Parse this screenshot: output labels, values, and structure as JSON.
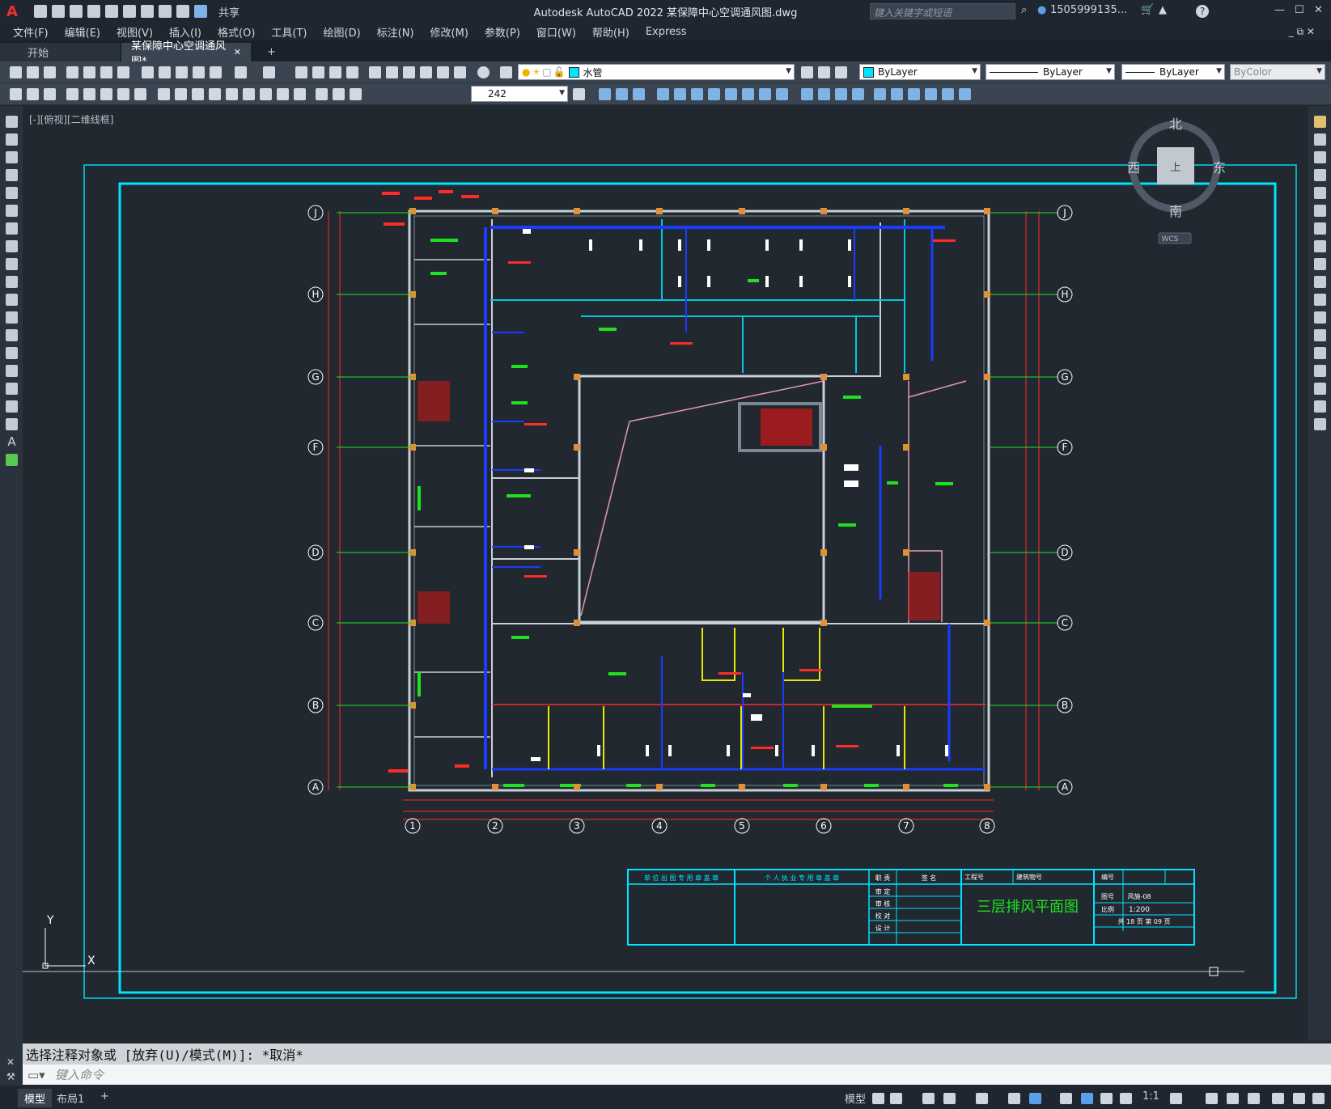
{
  "app": {
    "title": "Autodesk AutoCAD 2022    某保障中心空调通风图.dwg",
    "logo": "A",
    "share": "共享",
    "search_placeholder": "键入关键字或短语",
    "user": "1505999135...",
    "help": "?"
  },
  "menu": [
    "文件(F)",
    "编辑(E)",
    "视图(V)",
    "插入(I)",
    "格式(O)",
    "工具(T)",
    "绘图(D)",
    "标注(N)",
    "修改(M)",
    "参数(P)",
    "窗口(W)",
    "帮助(H)",
    "Express"
  ],
  "tabs": {
    "start": "开始",
    "doc": "某保障中心空调通风图*",
    "close": "✕",
    "add": "+"
  },
  "toolbar": {
    "layer": "水管",
    "color": "ByLayer",
    "linetype": "ByLayer",
    "lineweight": "ByLayer",
    "plotstyle": "ByColor",
    "dimscale": "242"
  },
  "viewport": {
    "label": "[-][俯视][二维线框]",
    "compass": {
      "north": "北",
      "south": "南",
      "east": "东",
      "west": "西",
      "center": "上",
      "wcs": "WCS"
    },
    "ucs": {
      "x": "X",
      "y": "Y"
    }
  },
  "drawing": {
    "grid_rows": [
      "J",
      "H",
      "G",
      "F",
      "D",
      "C",
      "B",
      "A"
    ],
    "grid_cols": [
      "1",
      "2",
      "3",
      "4",
      "5",
      "6",
      "7",
      "8"
    ],
    "title_block": {
      "unit_seal": "单 位 出 图 专 用 章 盖 章",
      "personal_seal": "个 人 执 业 专 用 章 盖 章",
      "role": "职 责",
      "sign": "签 名",
      "project_no": "工程号",
      "building_no": "建筑物号",
      "number": "编号",
      "drawing_title": "三层排风平面图",
      "drawing_no_label": "图号",
      "drawing_no": "风施-08",
      "scale_label": "比例",
      "scale": "1:200",
      "pages": "共   18   页  第   09   页",
      "roles": [
        "审 定",
        "审 核",
        "校 对",
        "设 计"
      ]
    }
  },
  "command": {
    "history": "选择注释对象或 [放弃(U)/模式(M)]: *取消*",
    "placeholder": "键入命令"
  },
  "status": {
    "tabs": [
      "模型",
      "布局1"
    ],
    "add": "+",
    "model_label": "模型",
    "scale": "1:1"
  },
  "colors": {
    "accent_red": "#e8322c",
    "cyan": "#00e5ff",
    "wall": "#c8cfd6",
    "duct_blue": "#1a3cff",
    "green_text": "#1ee31e",
    "red_dim": "#ff2a2a",
    "pink": "#e59ab3",
    "yellow": "#e8e800"
  }
}
